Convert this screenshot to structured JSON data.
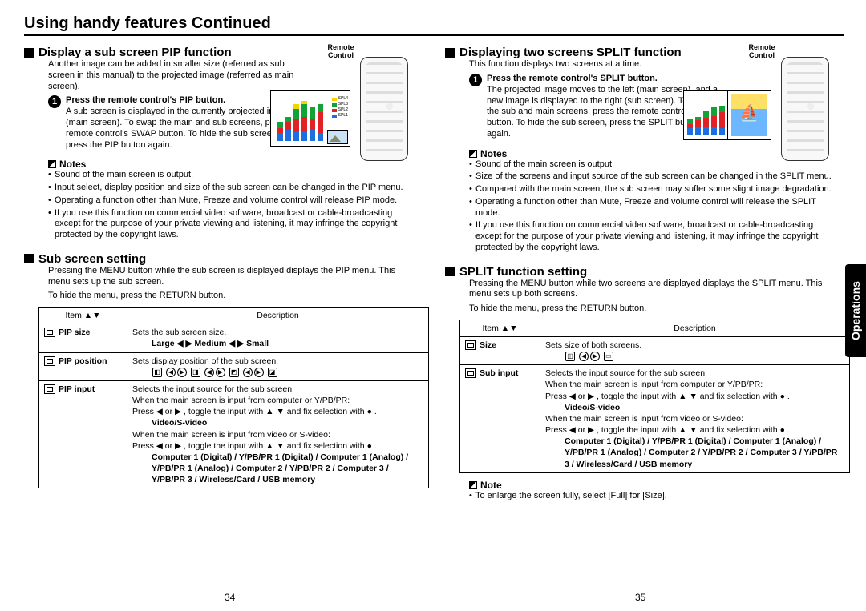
{
  "page_title": "Using handy features Continued",
  "side_tab": "Operations",
  "page_numbers": {
    "left": "34",
    "right": "35"
  },
  "remote_label": "Remote Control",
  "left": {
    "pip": {
      "heading": "Display a sub screen PIP function",
      "intro": "Another image can be added in smaller size (referred as sub screen in this manual) to the projected image (referred as main screen).",
      "step1_title": "Press the remote control's PIP button.",
      "step1_body": "A sub screen is displayed in the currently projected image (main screen). To swap the main and sub screens, press the remote control's SWAP button. To hide the sub screen, press the PIP button again.",
      "notes_title": "Notes",
      "notes": [
        "Sound of the main screen is output.",
        "Input select, display position and size of the sub screen can be changed in the PIP menu.",
        "Operating a function other than Mute, Freeze and volume control will release PIP mode.",
        "If you use this function on commercial video software, broadcast or cable-broadcasting except for the purpose of your private viewing and listening, it may infringe the copyright protected by the copyright laws."
      ]
    },
    "sub": {
      "heading": "Sub screen setting",
      "body1": "Pressing the MENU button while the sub screen is displayed displays the PIP menu. This menu sets up the sub screen.",
      "body2": "To hide the menu, press the RETURN button.",
      "table": {
        "h1": "Item ▲▼",
        "h2": "Description",
        "r1c1": "PIP size",
        "r1c2a": "Sets the sub screen size.",
        "r1c2b": "Large ◀ ▶ Medium ◀ ▶ Small",
        "r2c1": "PIP position",
        "r2c2a": "Sets display position of the sub screen.",
        "r3c1": "PIP input",
        "r3c2a": "Selects the input source for the sub screen.",
        "r3c2b": "When the main screen is input from computer or Y/PB/PR:",
        "r3c2c": "Press ◀ or ▶ , toggle the input with ▲ ▼ and fix selection with ● .",
        "r3c2d": "Video/S-video",
        "r3c2e": "When the main screen is input from video or S-video:",
        "r3c2f": "Press ◀ or ▶ , toggle the input with ▲ ▼ and fix selection with ● .",
        "r3c2g": "Computer 1 (Digital) / Y/PB/PR 1 (Digital) / Computer 1 (Analog) / Y/PB/PR 1 (Analog) / Computer 2 / Y/PB/PR 2 / Computer 3 / Y/PB/PR 3 / Wireless/Card / USB memory"
      }
    }
  },
  "right": {
    "split": {
      "heading": "Displaying two screens SPLIT function",
      "intro": "This function displays two screens at a time.",
      "step1_title": "Press the remote control's SPLIT button.",
      "step1_body": "The projected image moves to the left (main screen), and a new image is displayed to the right (sub screen). To switch the sub and main screens, press the remote control's SWAP button. To hide the sub screen, press the SPLIT button again.",
      "notes_title": "Notes",
      "notes": [
        "Sound of the main screen is output.",
        "Size of the screens and input source of the sub screen can be changed in the SPLIT menu.",
        "Compared with the main screen, the sub screen may suffer some slight image degradation.",
        "Operating a function other than Mute, Freeze and volume control will release the SPLIT mode.",
        "If you use this function on commercial video software, broadcast or cable-broadcasting except for the purpose of your private viewing and listening, it may infringe the copyright protected by the copyright laws."
      ]
    },
    "setting": {
      "heading": "SPLIT function setting",
      "body1": "Pressing the MENU button while two screens are displayed displays the SPLIT menu. This menu sets up both screens.",
      "body2": "To hide the menu, press the RETURN button.",
      "table": {
        "h1": "Item ▲▼",
        "h2": "Description",
        "r1c1": "Size",
        "r1c2a": "Sets size of both screens.",
        "r2c1": "Sub input",
        "r2c2a": "Selects the input source for the sub screen.",
        "r2c2b": "When the main screen is input from computer or Y/PB/PR:",
        "r2c2c": "Press ◀ or ▶ , toggle the input with ▲ ▼ and fix selection with ● .",
        "r2c2d": "Video/S-video",
        "r2c2e": "When the main screen is input from video or S-video:",
        "r2c2f": "Press ◀ or ▶ , toggle the input with ▲ ▼ and fix selection with ● .",
        "r2c2g": "Computer 1 (Digital) / Y/PB/PR 1 (Digital) / Computer 1 (Analog) / Y/PB/PR 1 (Analog) / Computer 2 / Y/PB/PR 2 / Computer 3 / Y/PB/PR 3 / Wireless/Card / USB memory"
      },
      "note_title": "Note",
      "note1": "To enlarge the screen fully, select [Full] for [Size]."
    }
  }
}
